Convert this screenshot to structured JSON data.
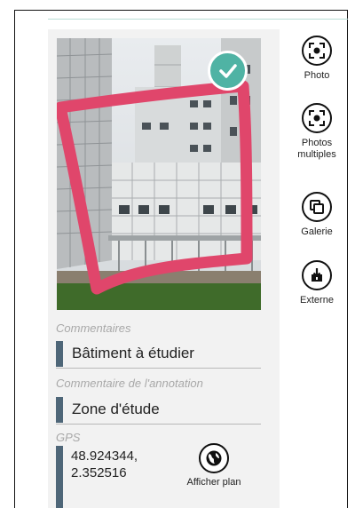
{
  "form": {
    "photo_alt": "Photo du bâtiment avec annotation",
    "commentaires": {
      "label": "Commentaires",
      "value": "Bâtiment à étudier"
    },
    "annotation": {
      "label": "Commentaire de l'annotation",
      "value": "Zone d'étude"
    },
    "gps": {
      "label": "GPS",
      "lat": "48.924344,",
      "lon": "2.352516"
    },
    "map_button": "Afficher plan"
  },
  "toolbar": [
    {
      "label": "Photo",
      "icon": "camera-focus-icon"
    },
    {
      "label": "Photos multiples",
      "icon": "camera-focus-icon"
    },
    {
      "label": "Galerie",
      "icon": "gallery-icon"
    },
    {
      "label": "Externe",
      "icon": "external-app-icon"
    }
  ],
  "colors": {
    "accent_bar": "#4e6678",
    "check_badge": "#4fb3a4",
    "annotation_stroke": "#e0466b"
  }
}
